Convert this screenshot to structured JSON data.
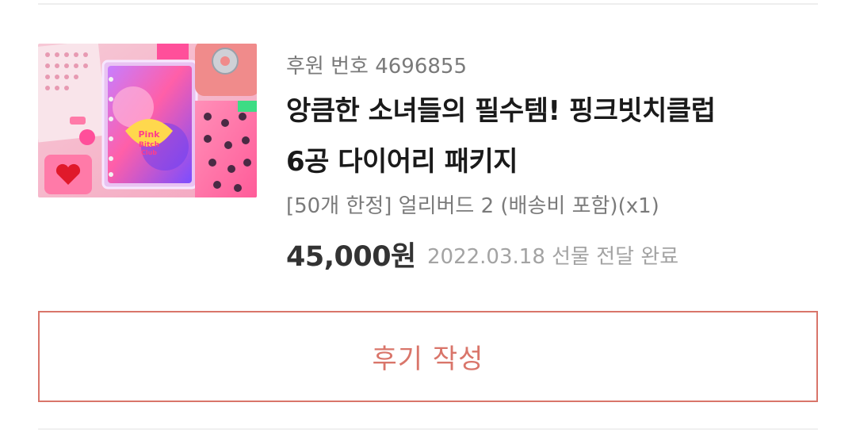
{
  "reward": {
    "sponsor_number": "후원 번호 4696855",
    "title_line1": "앙큼한 소녀들의 필수템! 핑크빗치클럽",
    "title_line2": "6공 다이어리 패키지",
    "option": "[50개 한정] 얼리버드 2 (배송비 포함)(x1)",
    "price": "45,000원",
    "delivery_status": "2022.03.18 선물 전달 완료",
    "thumbnail_logo": "Pink Bitch Club"
  },
  "actions": {
    "review_label": "후기 작성"
  },
  "colors": {
    "accent": "#d9756a",
    "muted_text": "#7a7a7a",
    "light_text": "#a3a3a3"
  }
}
